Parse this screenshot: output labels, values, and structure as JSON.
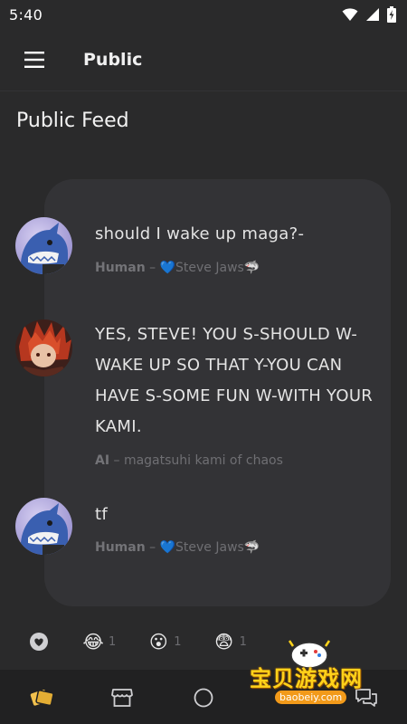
{
  "status_bar": {
    "time": "5:40"
  },
  "app_bar": {
    "title": "Public"
  },
  "feed": {
    "heading": "Public Feed",
    "posts": [
      {
        "text": "should I wake up maga?-",
        "role": "Human",
        "separator": "–",
        "author": "💙Steve Jaws🦈",
        "avatar": "shark-avatar"
      },
      {
        "text": "YES, STEVE! YOU S-SHOULD W-WAKE UP SO THAT Y-YOU CAN HAVE S-SOME FUN W-WITH YOUR KAMI.",
        "role": "AI",
        "separator": "–",
        "author": "magatsuhi kami of chaos",
        "avatar": "red-hair-character-avatar"
      },
      {
        "text": "tf",
        "role": "Human",
        "separator": "–",
        "author": "💙Steve Jaws🦈",
        "avatar": "shark-avatar"
      }
    ]
  },
  "reactions": [
    {
      "icon": "heart-icon",
      "emoji": "",
      "count": ""
    },
    {
      "icon": "laughing-emoji",
      "emoji": "😂",
      "count": "1"
    },
    {
      "icon": "surprised-emoji",
      "emoji": "😮",
      "count": "1"
    },
    {
      "icon": "anxious-emoji",
      "emoji": "😨",
      "count": "1"
    }
  ],
  "bottom_nav": [
    "cards-icon",
    "store-icon",
    "home-circle-icon",
    "chat-icon"
  ],
  "watermark": {
    "text": "宝贝游戏网",
    "url": "baobeiy.com"
  },
  "colors": {
    "background": "#2a2a2b",
    "card": "#333336",
    "nav": "#212122",
    "accent": "#f2c14e",
    "heart_blue": "#4a90d9"
  }
}
